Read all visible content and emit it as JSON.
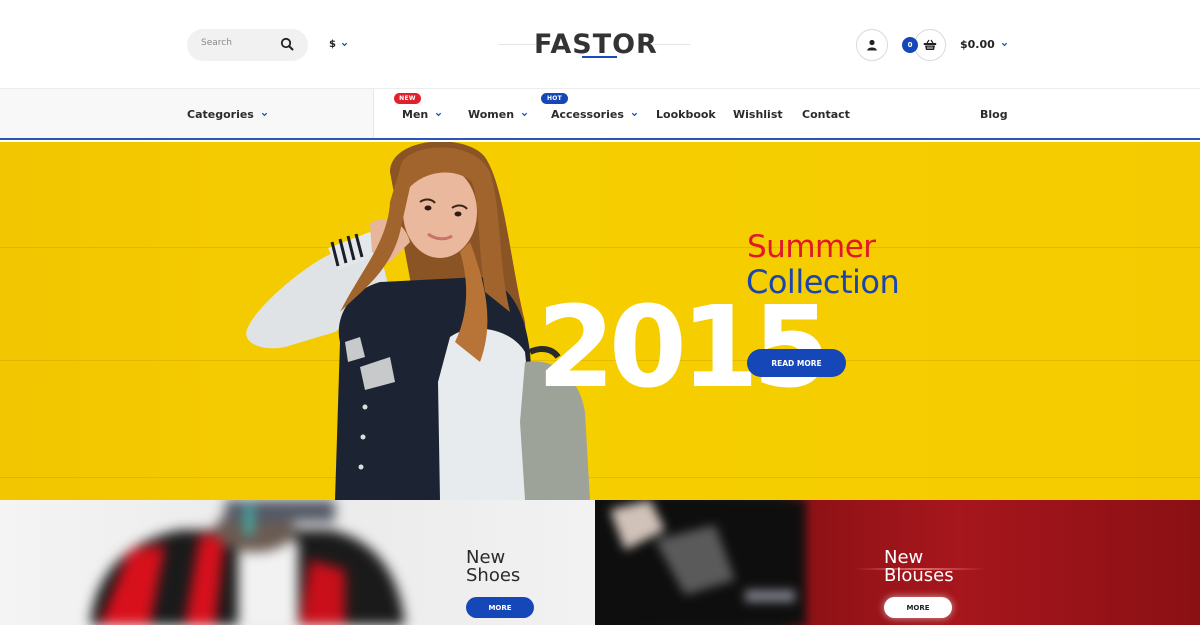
{
  "header": {
    "search": {
      "placeholder": "Search",
      "value": ""
    },
    "currency": {
      "selected": "$"
    },
    "logo": {
      "text": "FASTOR"
    },
    "account_icon": "user-icon",
    "cart": {
      "count": "0",
      "total": "$0.00",
      "icon": "basket-icon"
    }
  },
  "nav": {
    "categories_label": "Categories",
    "items": [
      {
        "label": "Men",
        "badge": "NEW",
        "dropdown": true
      },
      {
        "label": "Women",
        "dropdown": true
      },
      {
        "label": "Accessories",
        "badge": "HOT",
        "dropdown": true
      },
      {
        "label": "Lookbook"
      },
      {
        "label": "Wishlist"
      },
      {
        "label": "Contact"
      },
      {
        "label": "Blog"
      }
    ]
  },
  "hero": {
    "line1": "Summer",
    "line2": "Collection",
    "year": "2015",
    "button": "READ MORE"
  },
  "banners": [
    {
      "title_line1": "New",
      "title_line2": "Shoes",
      "button": "MORE"
    },
    {
      "title_line1": "New",
      "title_line2": "Blouses",
      "button": "MORE"
    }
  ],
  "colors": {
    "accent_blue": "#1547b8",
    "badge_red": "#e0202c",
    "hero_yellow": "#f4cb00",
    "summer_red": "#e0182a",
    "banner_red": "#a6161c"
  }
}
